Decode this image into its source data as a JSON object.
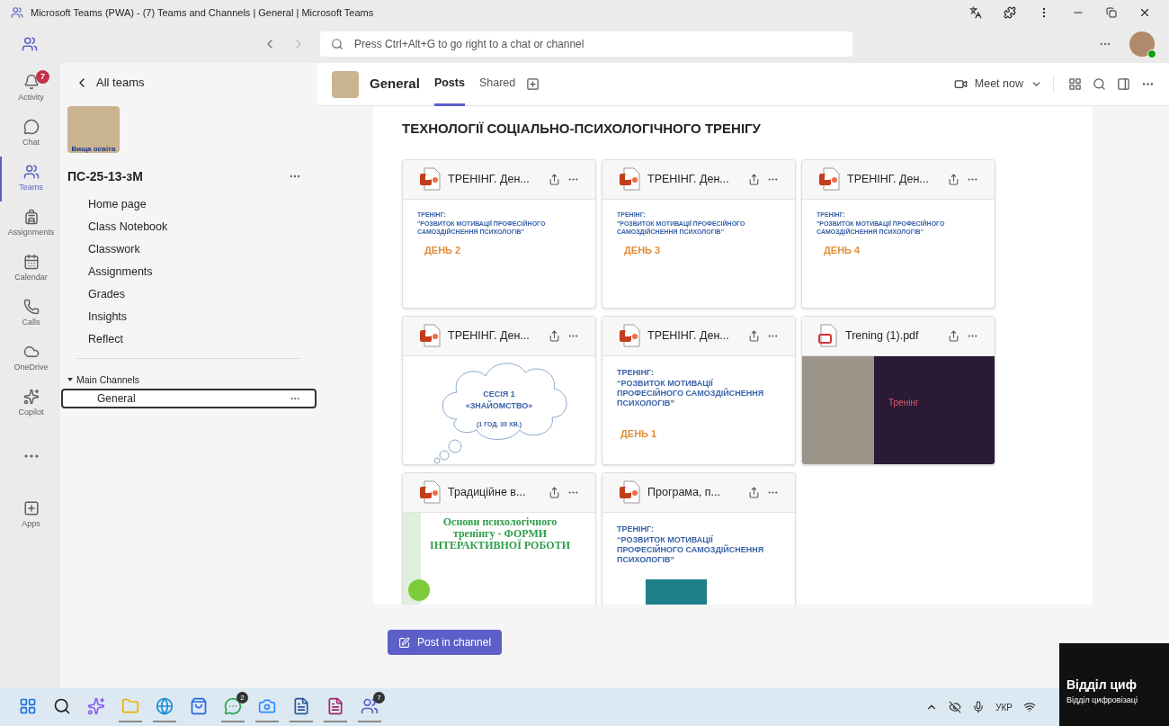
{
  "window": {
    "title": "Microsoft Teams (PWA) - (7) Teams and Channels | General | Microsoft Teams"
  },
  "search": {
    "placeholder": "Press Ctrl+Alt+G to go right to a chat or channel"
  },
  "rail": [
    {
      "kind": "activity",
      "label": "Activity",
      "badge": "7",
      "selected": false
    },
    {
      "kind": "chat",
      "label": "Chat",
      "selected": false
    },
    {
      "kind": "teams",
      "label": "Teams",
      "selected": true
    },
    {
      "kind": "assignments",
      "label": "Assignments",
      "selected": false
    },
    {
      "kind": "calendar",
      "label": "Calendar",
      "selected": false
    },
    {
      "kind": "calls",
      "label": "Calls",
      "selected": false
    },
    {
      "kind": "onedrive",
      "label": "OneDrive",
      "selected": false
    },
    {
      "kind": "copilot",
      "label": "Copilot",
      "selected": false
    },
    {
      "kind": "more",
      "selected": false
    },
    {
      "kind": "apps",
      "label": "Apps",
      "selected": false
    }
  ],
  "team_panel": {
    "back": "All teams",
    "logo_text": "Вища освіта",
    "team_name": "ПС-25-13-зМ",
    "items": [
      "Home page",
      "Class Notebook",
      "Classwork",
      "Assignments",
      "Grades",
      "Insights",
      "Reflect"
    ],
    "sections": [
      {
        "name": "Main Channels",
        "expanded": true,
        "channels": [
          {
            "name": "General",
            "selected": true
          }
        ]
      }
    ]
  },
  "channel_header": {
    "title": "General",
    "tabs": [
      {
        "label": "Posts",
        "selected": true
      },
      {
        "label": "Shared",
        "selected": false
      }
    ],
    "meet_now": "Meet now"
  },
  "content": {
    "heading": "ТЕХНОЛОГІЇ СОЦІАЛЬНО-ПСИХОЛОГІЧНОГО ТРЕНІГУ",
    "cards": [
      {
        "title": "ТРЕНІНГ. Ден...",
        "kind": "pptx",
        "preview": {
          "kind": "title_slide",
          "heading": "ТРЕНІНГ:",
          "subtitle": "\"РОЗВИТОК МОТИВАЦІЇ ПРОФЕСІЙНОГО САМОЗДІЙСНЕННЯ ПСИХОЛОГІВ\"",
          "day": "ДЕНЬ 2"
        }
      },
      {
        "title": "ТРЕНІНГ. Ден...",
        "kind": "pptx",
        "preview": {
          "kind": "title_slide",
          "heading": "ТРЕНІНГ:",
          "subtitle": "\"РОЗВИТОК МОТИВАЦІЇ ПРОФЕСІЙНОГО САМОЗДІЙСНЕННЯ ПСИХОЛОГІВ\"",
          "day": "ДЕНЬ 3"
        }
      },
      {
        "title": "ТРЕНІНГ. Ден...",
        "kind": "pptx",
        "preview": {
          "kind": "title_slide",
          "heading": "ТРЕНІНГ:",
          "subtitle": "\"РОЗВИТОК МОТИВАЦІЇ ПРОФЕСІЙНОГО САМОЗДІЙСНЕННЯ ПСИХОЛОГІВ\"",
          "day": "ДЕНЬ 4"
        }
      },
      {
        "title": "ТРЕНІНГ. Ден...",
        "kind": "pptx",
        "preview": {
          "kind": "cloud_slide",
          "session": "СЕСІЯ 1",
          "name": "«ЗНАЙОМСТВО»",
          "duration": "(1 ГОД. 30 ХВ.)"
        }
      },
      {
        "title": "ТРЕНІНГ. Ден...",
        "kind": "pptx",
        "preview": {
          "kind": "large_title_slide",
          "heading": "ТРЕНІНГ:",
          "subtitle": "“РОЗВИТОК МОТИВАЦІЇ ПРОФЕСІЙНОГО САМОЗДІЙСНЕННЯ ПСИХОЛОГІВ”",
          "day": "ДЕНЬ 1"
        }
      },
      {
        "title": "Trening (1).pdf",
        "kind": "pdf",
        "preview": {
          "kind": "photo_slide",
          "heading": "Тренінг"
        }
      },
      {
        "title": "Традиційне в...",
        "kind": "pptx",
        "preview": {
          "kind": "green_slide",
          "text": "Основи психологічного тренінгу - ФОРМИ ІНТЕРАКТИВНОЇ РОБОТИ"
        }
      },
      {
        "title": "Програма, п...",
        "kind": "pptx",
        "preview": {
          "kind": "image_title_slide",
          "heading": "ТРЕНІНГ:",
          "subtitle": "“РОЗВИТОК МОТИВАЦІЇ ПРОФЕСІЙНОГО САМОЗДІЙСНЕННЯ ПСИХОЛОГІВ”"
        }
      }
    ]
  },
  "compose": {
    "button": "Post in channel"
  },
  "video_overlay": {
    "title": "Відділ циф",
    "caption": "Відділ цифровізаці"
  },
  "taskbar": {
    "apps": [
      {
        "kind": "start",
        "active": false
      },
      {
        "kind": "search",
        "active": false
      },
      {
        "kind": "copilot",
        "active": false
      },
      {
        "kind": "files",
        "active": true
      },
      {
        "kind": "browser",
        "active": true
      },
      {
        "kind": "store",
        "active": false
      },
      {
        "kind": "whatsapp",
        "badge": "2",
        "active": true
      },
      {
        "kind": "zoom",
        "active": true
      },
      {
        "kind": "word",
        "active": true
      },
      {
        "kind": "pdf",
        "active": true
      },
      {
        "kind": "teams",
        "badge": "7",
        "active": true
      }
    ],
    "language": "УКР"
  }
}
